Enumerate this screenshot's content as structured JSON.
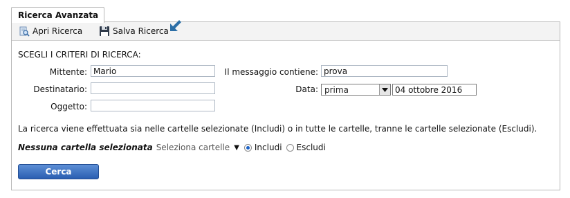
{
  "tab": {
    "label": "Ricerca Avanzata"
  },
  "toolbar": {
    "open_label": "Apri Ricerca",
    "save_label": "Salva Ricerca"
  },
  "form": {
    "section_title": "SCEGLI I CRITERI DI RICERCA:",
    "sender_label": "Mittente:",
    "sender_value": "Mario",
    "recipient_label": "Destinatario:",
    "recipient_value": "",
    "subject_label": "Oggetto:",
    "subject_value": "",
    "message_label": "Il messaggio contiene:",
    "message_value": "prova",
    "date_label": "Data:",
    "date_mode": "prima",
    "date_value": "04 ottobre 2016"
  },
  "info_text": "La ricerca viene effettuata sia nelle cartelle selezionate (Includi) o in tutte le cartelle, tranne le cartelle selezionate (Escludi).",
  "folders": {
    "none_selected": "Nessuna cartella selezionata",
    "select_label": "Seleziona cartelle",
    "include_label": "Includi",
    "exclude_label": "Escludi",
    "mode": "Includi"
  },
  "search_button": "Cerca",
  "colors": {
    "accent": "#2a5eb1",
    "arrow": "#2b6ea6",
    "toolbar_bg": "#f3f3f3"
  }
}
